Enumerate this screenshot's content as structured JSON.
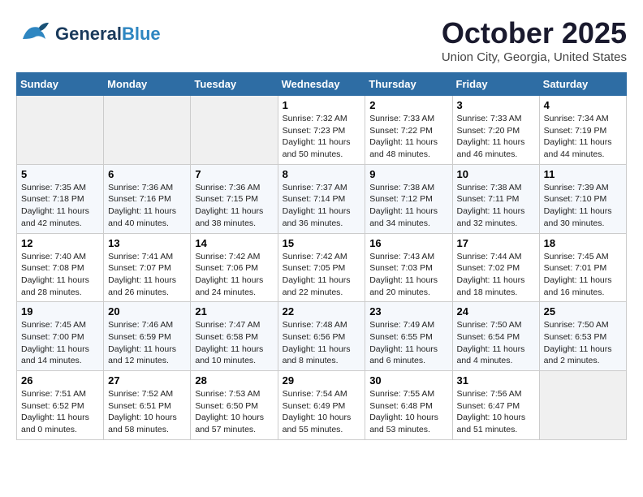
{
  "header": {
    "logo_general": "General",
    "logo_blue": "Blue",
    "month": "October 2025",
    "location": "Union City, Georgia, United States"
  },
  "days_of_week": [
    "Sunday",
    "Monday",
    "Tuesday",
    "Wednesday",
    "Thursday",
    "Friday",
    "Saturday"
  ],
  "weeks": [
    [
      {
        "day": "",
        "info": ""
      },
      {
        "day": "",
        "info": ""
      },
      {
        "day": "",
        "info": ""
      },
      {
        "day": "1",
        "info": "Sunrise: 7:32 AM\nSunset: 7:23 PM\nDaylight: 11 hours\nand 50 minutes."
      },
      {
        "day": "2",
        "info": "Sunrise: 7:33 AM\nSunset: 7:22 PM\nDaylight: 11 hours\nand 48 minutes."
      },
      {
        "day": "3",
        "info": "Sunrise: 7:33 AM\nSunset: 7:20 PM\nDaylight: 11 hours\nand 46 minutes."
      },
      {
        "day": "4",
        "info": "Sunrise: 7:34 AM\nSunset: 7:19 PM\nDaylight: 11 hours\nand 44 minutes."
      }
    ],
    [
      {
        "day": "5",
        "info": "Sunrise: 7:35 AM\nSunset: 7:18 PM\nDaylight: 11 hours\nand 42 minutes."
      },
      {
        "day": "6",
        "info": "Sunrise: 7:36 AM\nSunset: 7:16 PM\nDaylight: 11 hours\nand 40 minutes."
      },
      {
        "day": "7",
        "info": "Sunrise: 7:36 AM\nSunset: 7:15 PM\nDaylight: 11 hours\nand 38 minutes."
      },
      {
        "day": "8",
        "info": "Sunrise: 7:37 AM\nSunset: 7:14 PM\nDaylight: 11 hours\nand 36 minutes."
      },
      {
        "day": "9",
        "info": "Sunrise: 7:38 AM\nSunset: 7:12 PM\nDaylight: 11 hours\nand 34 minutes."
      },
      {
        "day": "10",
        "info": "Sunrise: 7:38 AM\nSunset: 7:11 PM\nDaylight: 11 hours\nand 32 minutes."
      },
      {
        "day": "11",
        "info": "Sunrise: 7:39 AM\nSunset: 7:10 PM\nDaylight: 11 hours\nand 30 minutes."
      }
    ],
    [
      {
        "day": "12",
        "info": "Sunrise: 7:40 AM\nSunset: 7:08 PM\nDaylight: 11 hours\nand 28 minutes."
      },
      {
        "day": "13",
        "info": "Sunrise: 7:41 AM\nSunset: 7:07 PM\nDaylight: 11 hours\nand 26 minutes."
      },
      {
        "day": "14",
        "info": "Sunrise: 7:42 AM\nSunset: 7:06 PM\nDaylight: 11 hours\nand 24 minutes."
      },
      {
        "day": "15",
        "info": "Sunrise: 7:42 AM\nSunset: 7:05 PM\nDaylight: 11 hours\nand 22 minutes."
      },
      {
        "day": "16",
        "info": "Sunrise: 7:43 AM\nSunset: 7:03 PM\nDaylight: 11 hours\nand 20 minutes."
      },
      {
        "day": "17",
        "info": "Sunrise: 7:44 AM\nSunset: 7:02 PM\nDaylight: 11 hours\nand 18 minutes."
      },
      {
        "day": "18",
        "info": "Sunrise: 7:45 AM\nSunset: 7:01 PM\nDaylight: 11 hours\nand 16 minutes."
      }
    ],
    [
      {
        "day": "19",
        "info": "Sunrise: 7:45 AM\nSunset: 7:00 PM\nDaylight: 11 hours\nand 14 minutes."
      },
      {
        "day": "20",
        "info": "Sunrise: 7:46 AM\nSunset: 6:59 PM\nDaylight: 11 hours\nand 12 minutes."
      },
      {
        "day": "21",
        "info": "Sunrise: 7:47 AM\nSunset: 6:58 PM\nDaylight: 11 hours\nand 10 minutes."
      },
      {
        "day": "22",
        "info": "Sunrise: 7:48 AM\nSunset: 6:56 PM\nDaylight: 11 hours\nand 8 minutes."
      },
      {
        "day": "23",
        "info": "Sunrise: 7:49 AM\nSunset: 6:55 PM\nDaylight: 11 hours\nand 6 minutes."
      },
      {
        "day": "24",
        "info": "Sunrise: 7:50 AM\nSunset: 6:54 PM\nDaylight: 11 hours\nand 4 minutes."
      },
      {
        "day": "25",
        "info": "Sunrise: 7:50 AM\nSunset: 6:53 PM\nDaylight: 11 hours\nand 2 minutes."
      }
    ],
    [
      {
        "day": "26",
        "info": "Sunrise: 7:51 AM\nSunset: 6:52 PM\nDaylight: 11 hours\nand 0 minutes."
      },
      {
        "day": "27",
        "info": "Sunrise: 7:52 AM\nSunset: 6:51 PM\nDaylight: 10 hours\nand 58 minutes."
      },
      {
        "day": "28",
        "info": "Sunrise: 7:53 AM\nSunset: 6:50 PM\nDaylight: 10 hours\nand 57 minutes."
      },
      {
        "day": "29",
        "info": "Sunrise: 7:54 AM\nSunset: 6:49 PM\nDaylight: 10 hours\nand 55 minutes."
      },
      {
        "day": "30",
        "info": "Sunrise: 7:55 AM\nSunset: 6:48 PM\nDaylight: 10 hours\nand 53 minutes."
      },
      {
        "day": "31",
        "info": "Sunrise: 7:56 AM\nSunset: 6:47 PM\nDaylight: 10 hours\nand 51 minutes."
      },
      {
        "day": "",
        "info": ""
      }
    ]
  ]
}
